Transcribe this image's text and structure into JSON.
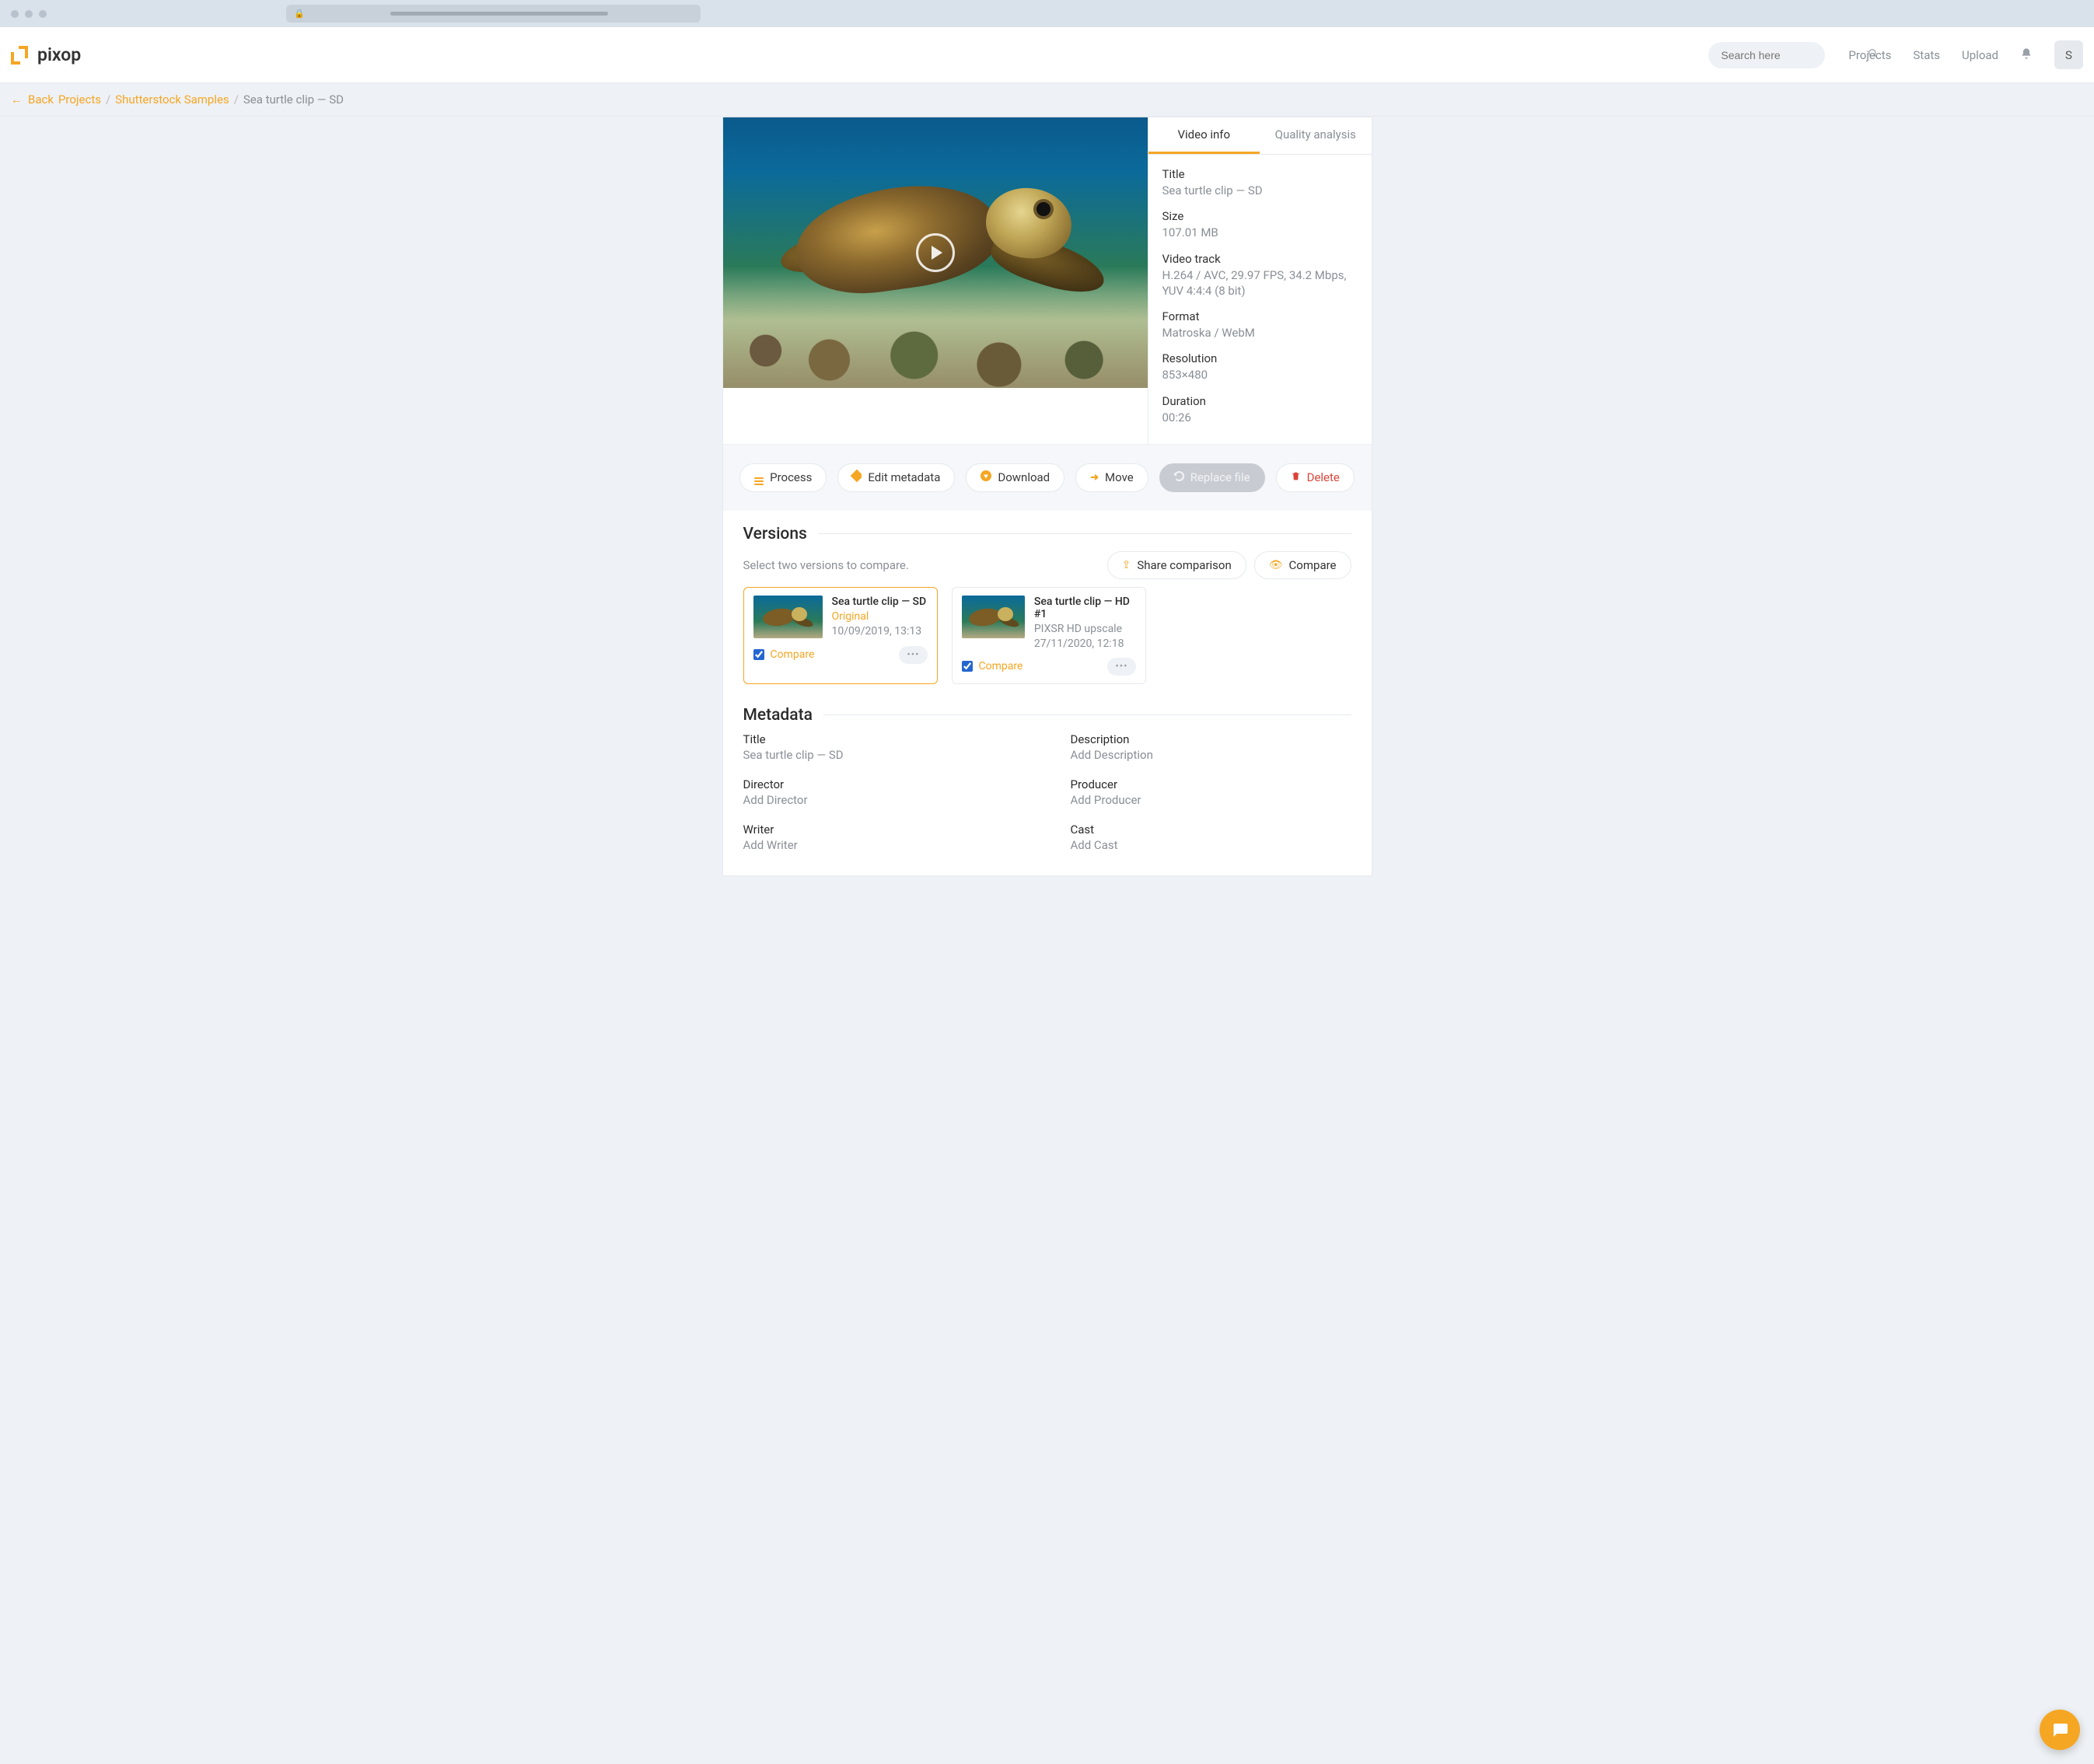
{
  "header": {
    "brand": "pixop",
    "search_placeholder": "Search here",
    "nav": {
      "projects": "Projects",
      "stats": "Stats",
      "upload": "Upload"
    },
    "avatar_initial": "S"
  },
  "breadcrumb": {
    "back": "Back",
    "items": [
      "Projects",
      "Shutterstock Samples"
    ],
    "current": "Sea turtle clip — SD"
  },
  "tabs": {
    "video_info": "Video info",
    "quality": "Quality analysis"
  },
  "info": {
    "title_label": "Title",
    "title_value": "Sea turtle clip — SD",
    "size_label": "Size",
    "size_value": "107.01 MB",
    "track_label": "Video track",
    "track_value": "H.264 / AVC, 29.97 FPS, 34.2 Mbps, YUV 4:4:4 (8 bit)",
    "format_label": "Format",
    "format_value": "Matroska / WebM",
    "res_label": "Resolution",
    "res_value": "853×480",
    "dur_label": "Duration",
    "dur_value": "00:26"
  },
  "actions": {
    "process": "Process",
    "edit": "Edit metadata",
    "download": "Download",
    "move": "Move",
    "replace": "Replace file",
    "delete": "Delete"
  },
  "versions": {
    "heading": "Versions",
    "subtitle": "Select two versions to compare.",
    "share": "Share comparison",
    "compare_btn": "Compare",
    "compare_label": "Compare",
    "cards": [
      {
        "title": "Sea turtle clip — SD",
        "tag": "Original",
        "tag_style": "orange",
        "ts": "10/09/2019, 13:13",
        "checked": true,
        "selected": true
      },
      {
        "title": "Sea turtle clip — HD #1",
        "tag": "PIXSR HD upscale",
        "tag_style": "gray",
        "ts": "27/11/2020, 12:18",
        "checked": true,
        "selected": false
      }
    ]
  },
  "metadata": {
    "heading": "Metadata",
    "items": [
      {
        "label": "Title",
        "value": "Sea turtle clip — SD"
      },
      {
        "label": "Description",
        "value": "Add Description"
      },
      {
        "label": "Director",
        "value": "Add Director"
      },
      {
        "label": "Producer",
        "value": "Add Producer"
      },
      {
        "label": "Writer",
        "value": "Add Writer"
      },
      {
        "label": "Cast",
        "value": "Add Cast"
      }
    ]
  }
}
